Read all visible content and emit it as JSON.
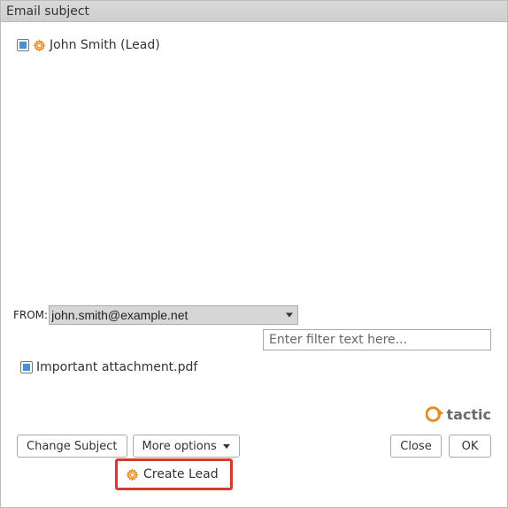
{
  "title": "Email subject",
  "contacts": [
    {
      "checked": true,
      "icon": "gear-icon",
      "label": "John Smith (Lead)"
    }
  ],
  "from": {
    "label": "FROM:",
    "value": "john.smith@example.net"
  },
  "filter": {
    "placeholder": "Enter filter text here..."
  },
  "attachments": [
    {
      "checked": true,
      "label": "Important attachment.pdf"
    }
  ],
  "logo": {
    "text": "tactic"
  },
  "buttons": {
    "change_subject": "Change Subject",
    "more_options": "More options",
    "close": "Close",
    "ok": "OK"
  },
  "menu": {
    "create_lead": "Create Lead"
  },
  "colors": {
    "accent": "#e58a1f",
    "highlight_border": "#d43a2f",
    "checkbox_fill": "#4a8fd6"
  }
}
